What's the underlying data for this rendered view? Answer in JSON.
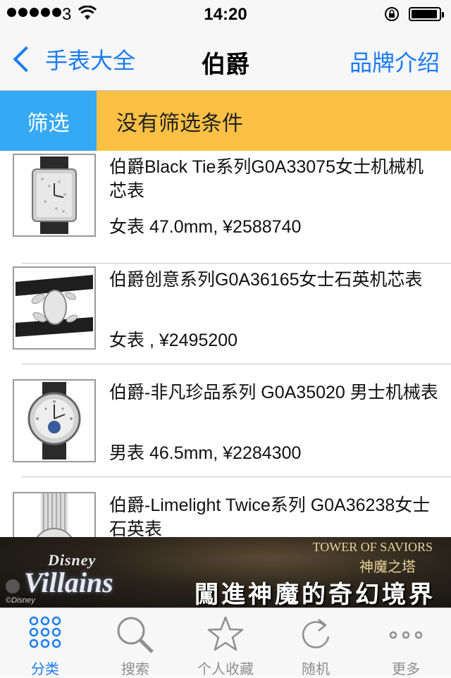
{
  "status_bar": {
    "carrier": "3",
    "time": "14:20"
  },
  "nav": {
    "back_label": "手表大全",
    "title": "伯爵",
    "right_label": "品牌介绍"
  },
  "filter": {
    "button_label": "筛选",
    "status": "没有筛选条件"
  },
  "products": [
    {
      "name": "伯爵Black Tie系列G0A33075女士机械机芯表",
      "meta": "女表 47.0mm, ¥2588740"
    },
    {
      "name": "伯爵创意系列G0A36165女士石英机芯表",
      "meta": "女表 , ¥2495200"
    },
    {
      "name": "伯爵-非凡珍品系列 G0A35020 男士机械表",
      "meta": "男表 46.5mm, ¥2284300"
    },
    {
      "name": "伯爵-Limelight Twice系列 G0A36238女士石英表",
      "meta": ""
    }
  ],
  "ad": {
    "brand_line1": "Disney",
    "brand_line2": "Villains",
    "game_title": "TOWER OF SAVIORS",
    "game_title_cn": "神魔之塔",
    "slogan": "闖進神魔的奇幻境界",
    "small_logo": "©Disney"
  },
  "tabs": [
    {
      "label": "分类",
      "icon": "grid-dots-icon",
      "active": true
    },
    {
      "label": "搜索",
      "icon": "search-icon",
      "active": false
    },
    {
      "label": "个人收藏",
      "icon": "star-icon",
      "active": false
    },
    {
      "label": "随机",
      "icon": "refresh-icon",
      "active": false
    },
    {
      "label": "更多",
      "icon": "more-dots-icon",
      "active": false
    }
  ],
  "colors": {
    "accent": "#1a7cf5",
    "filter_blue": "#36a9f5",
    "filter_yellow": "#fcc144",
    "tab_inactive": "#8e8e8e"
  }
}
